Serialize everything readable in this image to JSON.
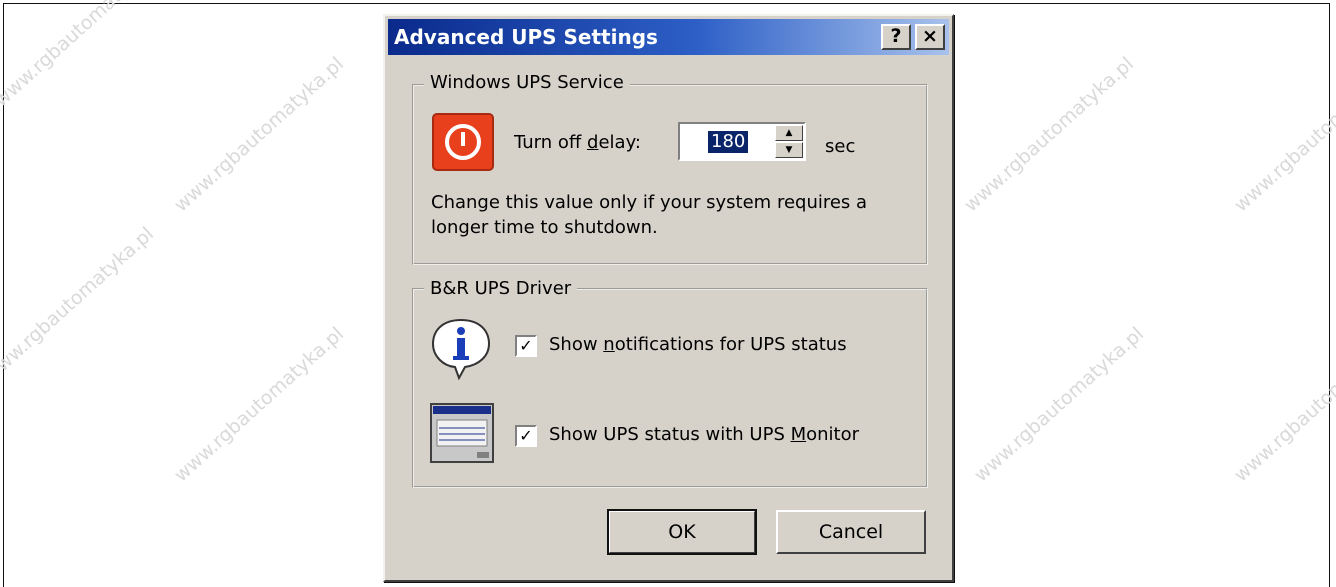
{
  "watermark": "www.rgbautomatyka.pl",
  "dialog": {
    "title": "Advanced UPS Settings",
    "help_button": "?",
    "close_button": "×"
  },
  "ups_service": {
    "group_label": "Windows UPS Service",
    "icon": "power-icon",
    "delay_label_before": "Turn off ",
    "delay_label_mnemonic": "d",
    "delay_label_after": "elay:",
    "delay_value": "180",
    "unit": "sec",
    "note_line1": "Change this value only if your system requires a",
    "note_line2": "longer time to shutdown."
  },
  "ups_driver": {
    "group_label": "B&R UPS Driver",
    "info_icon": "info-balloon-icon",
    "monitor_icon": "ups-monitor-icon",
    "notify": {
      "checked": true,
      "label_before": "Show ",
      "label_mnemonic": "n",
      "label_after": "otifications for UPS status"
    },
    "monitor": {
      "checked": true,
      "label_before": "Show UPS status with UPS ",
      "label_mnemonic": "M",
      "label_after": "onitor"
    }
  },
  "buttons": {
    "ok": "OK",
    "cancel": "Cancel"
  },
  "colors": {
    "title_start": "#0a2a8c",
    "title_end": "#a8c2ec",
    "dialog_bg": "#d6d2ca",
    "power_icon": "#e8401c"
  }
}
